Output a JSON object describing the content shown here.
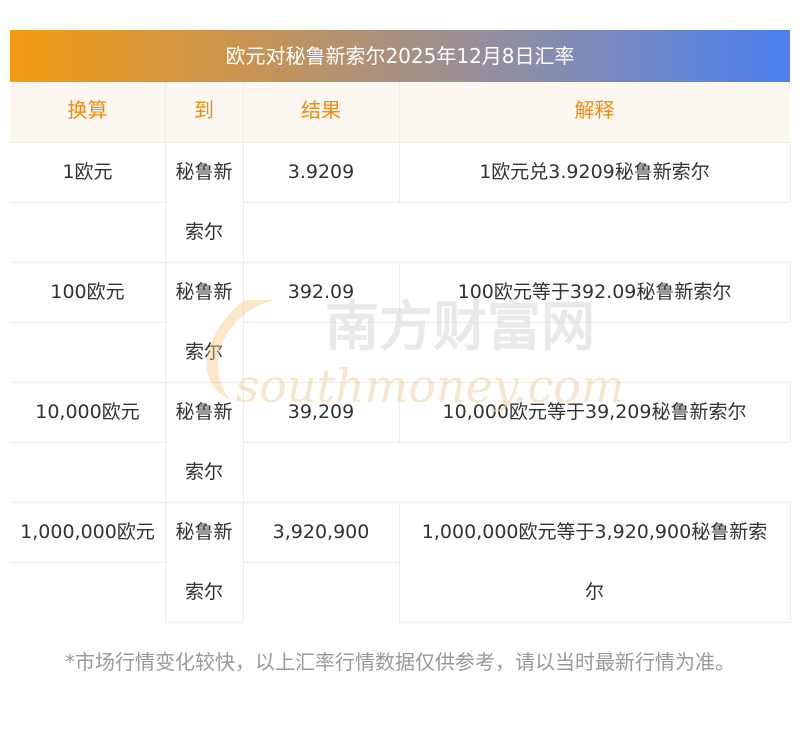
{
  "title": "欧元对秘鲁新索尔2025年12月8日汇率",
  "headers": [
    "换算",
    "到",
    "结果",
    "解释"
  ],
  "rows": [
    {
      "from": "1欧元",
      "to_line1": "秘鲁新",
      "to_line2": "索尔",
      "result": "3.9209",
      "explain_line1": "1欧元兑3.9209秘鲁新索尔",
      "explain_line2": ""
    },
    {
      "from": "100欧元",
      "to_line1": "秘鲁新",
      "to_line2": "索尔",
      "result": "392.09",
      "explain_line1": "100欧元等于392.09秘鲁新索尔",
      "explain_line2": ""
    },
    {
      "from": "10,000欧元",
      "to_line1": "秘鲁新",
      "to_line2": "索尔",
      "result": "39,209",
      "explain_line1": "10,000欧元等于39,209秘鲁新索尔",
      "explain_line2": ""
    },
    {
      "from": "1,000,000欧元",
      "to_line1": "秘鲁新",
      "to_line2": "索尔",
      "result": "3,920,900",
      "explain_line1": "1,000,000欧元等于3,920,900秘鲁新索",
      "explain_line2": "尔"
    }
  ],
  "note": "*市场行情变化较快，以上汇率行情数据仅供参考，请以当时最新行情为准。",
  "watermark": {
    "cn": "南方财富网",
    "en": "southmoney.com"
  },
  "colors": {
    "header_text": "#f08c0a",
    "header_bg": "#fdf7f1",
    "gradient_start": "#f39b12",
    "gradient_end": "#4a7ff0"
  }
}
